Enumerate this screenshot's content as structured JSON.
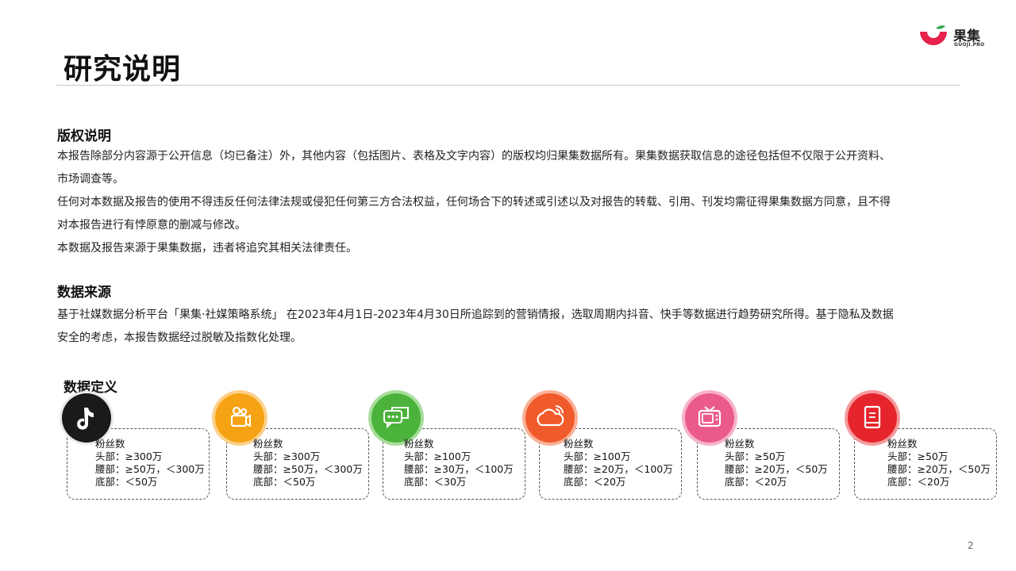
{
  "header": {
    "title": "研究说明",
    "logo_name": "果集",
    "logo_sub": "GUOJI.PRO"
  },
  "copyright": {
    "title": "版权说明",
    "lines": [
      "本报告除部分内容源于公开信息（均已备注）外，其他内容（包括图片、表格及文字内容）的版权均归果集数据所有。果集数据获取信息的途径包括但不仅限于公开资料、",
      "市场调查等。",
      "任何对本数据及报告的使用不得违反任何法律法规或侵犯任何第三方合法权益，任何场合下的转述或引述以及对报告的转载、引用、刊发均需征得果集数据方同意，且不得",
      "对本报告进行有悖原意的删减与修改。",
      "本数据及报告来源于果集数据，违者将追究其相关法律责任。"
    ]
  },
  "data_source": {
    "title": "数据来源",
    "lines": [
      "基于社媒数据分析平台「果集·社媒策略系统」 在2023年4月1日-2023年4月30日所追踪到的营销情报，选取周期内抖音、快手等数据进行趋势研究所得。基于隐私及数据",
      "安全的考虑，本报告数据经过脱敏及指数化处理。"
    ]
  },
  "definitions": {
    "title": "数据定义",
    "cards": [
      {
        "icon": "douyin-music-note-icon",
        "color": "#1a1a1a",
        "label": "粉丝数",
        "head": "头部：≥300万",
        "waist": "腰部：≥50万，＜300万",
        "tail": "底部：＜50万"
      },
      {
        "icon": "kuaishou-video-camera-icon",
        "color": "#f5a314",
        "label": "粉丝数",
        "head": "头部：≥300万",
        "waist": "腰部：≥50万，＜300万",
        "tail": "底部：＜50万"
      },
      {
        "icon": "wechat-chat-bubbles-icon",
        "color": "#4bb33b",
        "label": "粉丝数",
        "head": "头部：≥100万",
        "waist": "腰部：≥30万，＜100万",
        "tail": "底部：＜30万"
      },
      {
        "icon": "weibo-cloud-icon",
        "color": "#f15a2b",
        "label": "粉丝数",
        "head": "头部：≥100万",
        "waist": "腰部：≥20万，＜100万",
        "tail": "底部：＜20万"
      },
      {
        "icon": "bilibili-tv-icon",
        "color": "#ea5a8a",
        "label": "粉丝数",
        "head": "头部：≥50万",
        "waist": "腰部：≥20万，＜50万",
        "tail": "底部：＜20万"
      },
      {
        "icon": "xiaohongshu-book-icon",
        "color": "#e5242b",
        "label": "粉丝数",
        "head": "头部：≥50万",
        "waist": "腰部：≥20万，＜50万",
        "tail": "底部：＜20万"
      }
    ]
  },
  "page_number": "2"
}
